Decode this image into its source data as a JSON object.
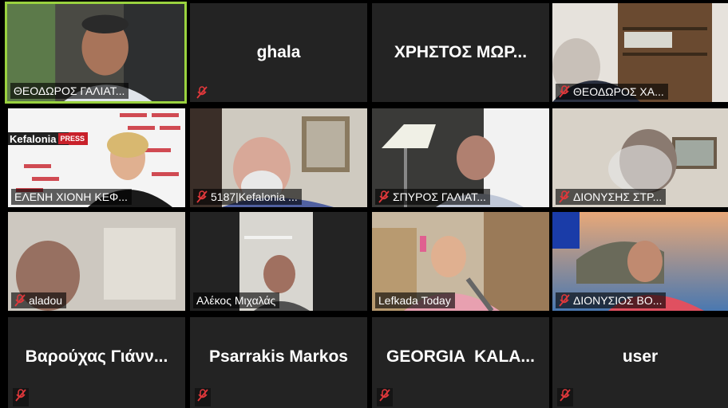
{
  "tiles": [
    {
      "name": "ΘΕΟΔΩΡΟΣ ΓΑΛΙΑΤ...",
      "muted": false
    },
    {
      "name": "ghala",
      "muted": true
    },
    {
      "name": "ΧΡΗΣΤΟΣ ΜΩΡ...",
      "muted": false
    },
    {
      "name": "ΘΕΟΔΩΡΟΣ ΧΑ...",
      "muted": true
    },
    {
      "name": "ΕΛΕΝΗ ΧΙΟΝΗ ΚΕΦ...",
      "muted": false
    },
    {
      "name": "5187|Kefalonia ...",
      "muted": true
    },
    {
      "name": "ΣΠΥΡΟΣ ΓΑΛΙΑΤ...",
      "muted": true
    },
    {
      "name": "ΔΙΟΝΥΣΗΣ ΣΤΡ...",
      "muted": true
    },
    {
      "name": "aladou",
      "muted": true
    },
    {
      "name": "Αλέκος Μιχαλάς",
      "muted": false
    },
    {
      "name": "Lefkada Today",
      "muted": false
    },
    {
      "name": "ΔΙΟΝΥΣΙΟΣ ΒΟ...",
      "muted": true
    },
    {
      "name": "Βαρούχας Γιάνν...",
      "muted": true
    },
    {
      "name": "Psarrakis Markos",
      "muted": true
    },
    {
      "name": "GEORGIA  KALA...",
      "muted": true
    },
    {
      "name": "user",
      "muted": true
    }
  ],
  "backdrop_text": {
    "logo": "Kefalonia",
    "logo_badge": "PRESS"
  },
  "colors": {
    "active_border": "#9ad23f",
    "tile_bg": "#232323",
    "muted_icon": "#e0383b"
  }
}
